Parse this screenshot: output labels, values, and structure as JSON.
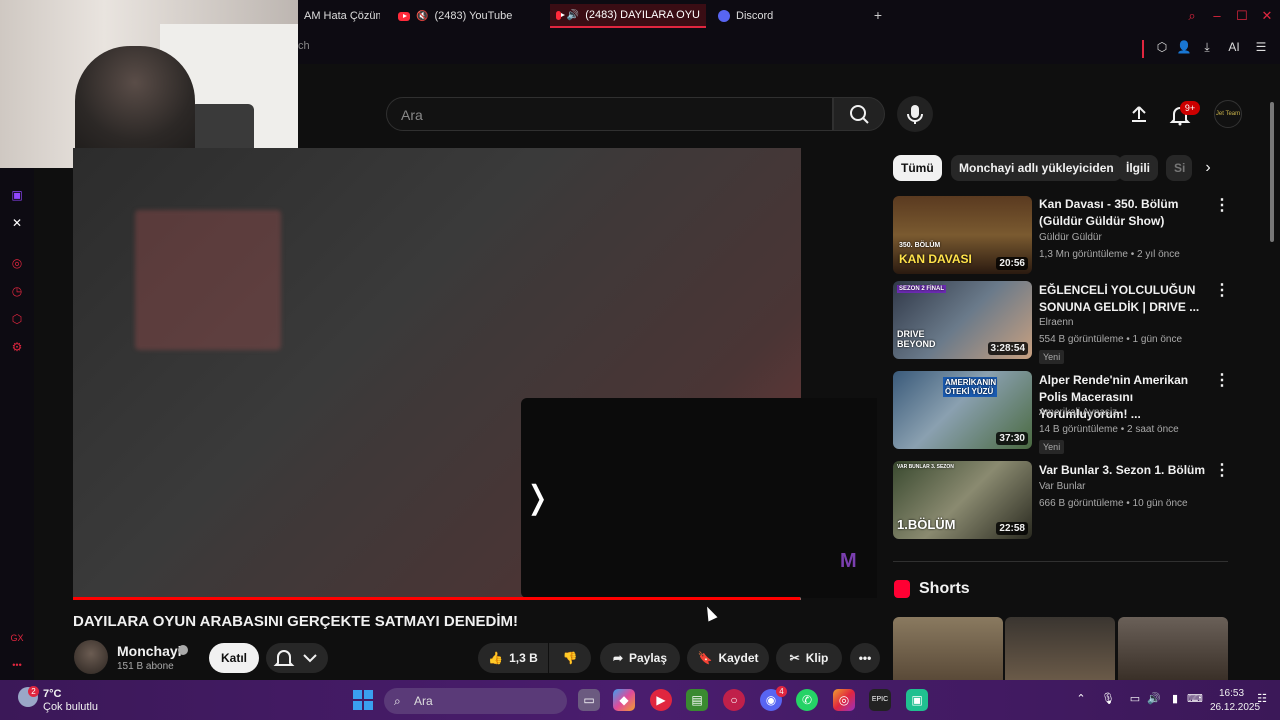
{
  "browser": {
    "tabs": [
      {
        "label": "AM Hata Çözüm",
        "type": "generic"
      },
      {
        "label": "(2483) YouTube",
        "type": "youtube",
        "muted": true
      },
      {
        "label": "(2483) DAYILARA OYU",
        "type": "youtube",
        "active": true
      },
      {
        "label": "Discord",
        "type": "discord"
      }
    ],
    "new_tab_label": "+",
    "address_partial": "ch",
    "ai_label": "AI",
    "accent_color": "#e0263f"
  },
  "youtube": {
    "search_placeholder": "Ara",
    "notification_count": "9+",
    "avatar_text": "Jet Team"
  },
  "video": {
    "title": "DAYILARA OYUN ARABASINI GERÇEKTE SATMAYI DENEDİM!",
    "channel": "Monchayi",
    "subscribers": "151 B abone",
    "join_label": "Katıl",
    "like_count": "1,3 B",
    "share_label": "Paylaş",
    "save_label": "Kaydet",
    "clip_label": "Klip",
    "more_label": "•••",
    "overlay_arrow": "❭",
    "overlay_logo": "M",
    "progress": 0.999
  },
  "chips": [
    {
      "label": "Tümü",
      "active": true
    },
    {
      "label": "Monchayi adlı yükleyiciden"
    },
    {
      "label": "İlgili"
    },
    {
      "label": "Si"
    }
  ],
  "recommendations": [
    {
      "title": "Kan Davası - 350. Bölüm (Güldür Güldür Show)",
      "channel": "Güldür Güldür",
      "meta": "1,3 Mn görüntüleme • 2 yıl önce",
      "duration": "20:56",
      "thumb_text": "KAN DAVASI",
      "thumb_top": "350. BÖLÜM",
      "new": ""
    },
    {
      "title": "EĞLENCELİ YOLCULUĞUN SONUNA GELDİK | DRIVE ...",
      "channel": "Elraenn",
      "meta": "554 B görüntüleme • 1 gün önce",
      "duration": "3:28:54",
      "thumb_text": "DRIVE BEYOND",
      "thumb_top": "SEZON 2  FİNAL",
      "new": "Yeni"
    },
    {
      "title": "Alper Rende'nin Amerikan Polis Macerasını Yorumluyorum! ...",
      "channel": "Amerikali Aynasiz",
      "meta": "14 B görüntüleme • 2 saat önce",
      "duration": "37:30",
      "thumb_text": "AMERİKANIN ÖTEKİ YÜZÜ",
      "thumb_top": "",
      "new": "Yeni"
    },
    {
      "title": "Var Bunlar 3. Sezon 1. Bölüm",
      "channel": "Var Bunlar",
      "meta": "666 B görüntüleme • 10 gün önce",
      "duration": "22:58",
      "thumb_text": "1.BÖLÜM",
      "thumb_top": "VAR BUNLAR 3. SEZON",
      "new": ""
    }
  ],
  "shorts": {
    "title": "Shorts"
  },
  "taskbar": {
    "temperature": "7°C",
    "weather": "Çok bulutlu",
    "weather_badge": "2",
    "search_label": "Ara",
    "time": "16:53",
    "date": "26.12.2025",
    "discord_badge": "4"
  },
  "sidebar": {
    "gx_label": "GX",
    "more_label": "•••"
  }
}
